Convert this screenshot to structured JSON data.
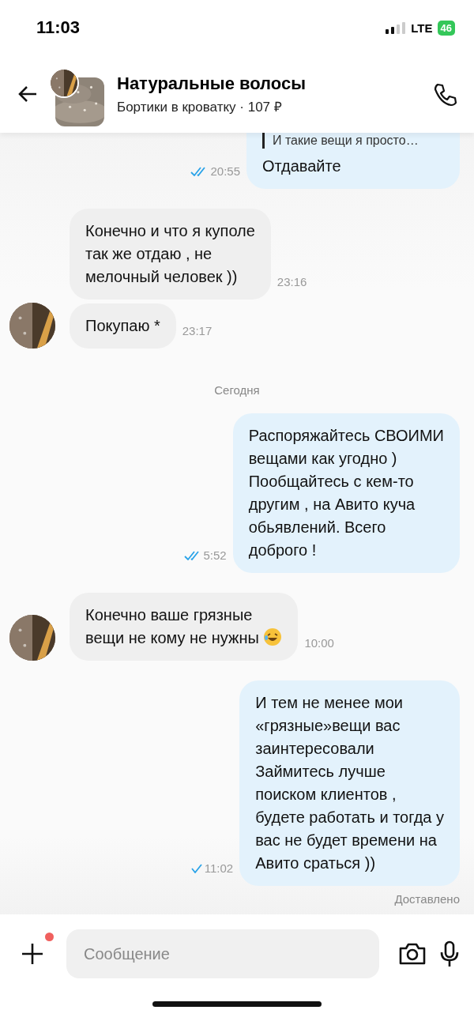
{
  "status_bar": {
    "time": "11:03",
    "network": "LTE",
    "battery": "46"
  },
  "header": {
    "title": "Натуральные волосы",
    "subtitle": "Бортики в кроватку · 107 ₽"
  },
  "messages": [
    {
      "kind": "outgoing",
      "quote": "И такие вещи я просто…",
      "text": "Отдавайте",
      "time": "20:55",
      "read": true,
      "top_cut": true
    },
    {
      "kind": "incoming",
      "text": "Конечно и что я куполе\nтак же отдаю , не\nмелочный человек ))",
      "time": "23:16",
      "avatar": false
    },
    {
      "kind": "incoming",
      "text": "Покупаю *",
      "time": "23:17",
      "avatar": true
    },
    {
      "kind": "date",
      "text": "Сегодня"
    },
    {
      "kind": "outgoing",
      "text": "Распоряжайтесь СВОИМИ\nвещами как угодно )\nПообщайтесь с кем-то\nдругим , на Авито куча\nобьявлений. Всего\nдоброго !",
      "time": "5:52",
      "read": true
    },
    {
      "kind": "incoming",
      "text": "Конечно ваше грязные\nвещи не кому не нужны",
      "emoji": true,
      "time": "10:00",
      "avatar": true
    },
    {
      "kind": "outgoing",
      "text": "И тем не менее мои\n«грязные»вещи вас\nзаинтересовали\nЗаймитесь лучше\nпоиском клиентов ,\nбудете работать и тогда у\nвас не будет времени на\nАвито сраться ))",
      "time": "11:02",
      "read": false
    }
  ],
  "delivery_status": "Доставлено",
  "composer": {
    "placeholder": "Сообщение",
    "attach_badge": true
  }
}
